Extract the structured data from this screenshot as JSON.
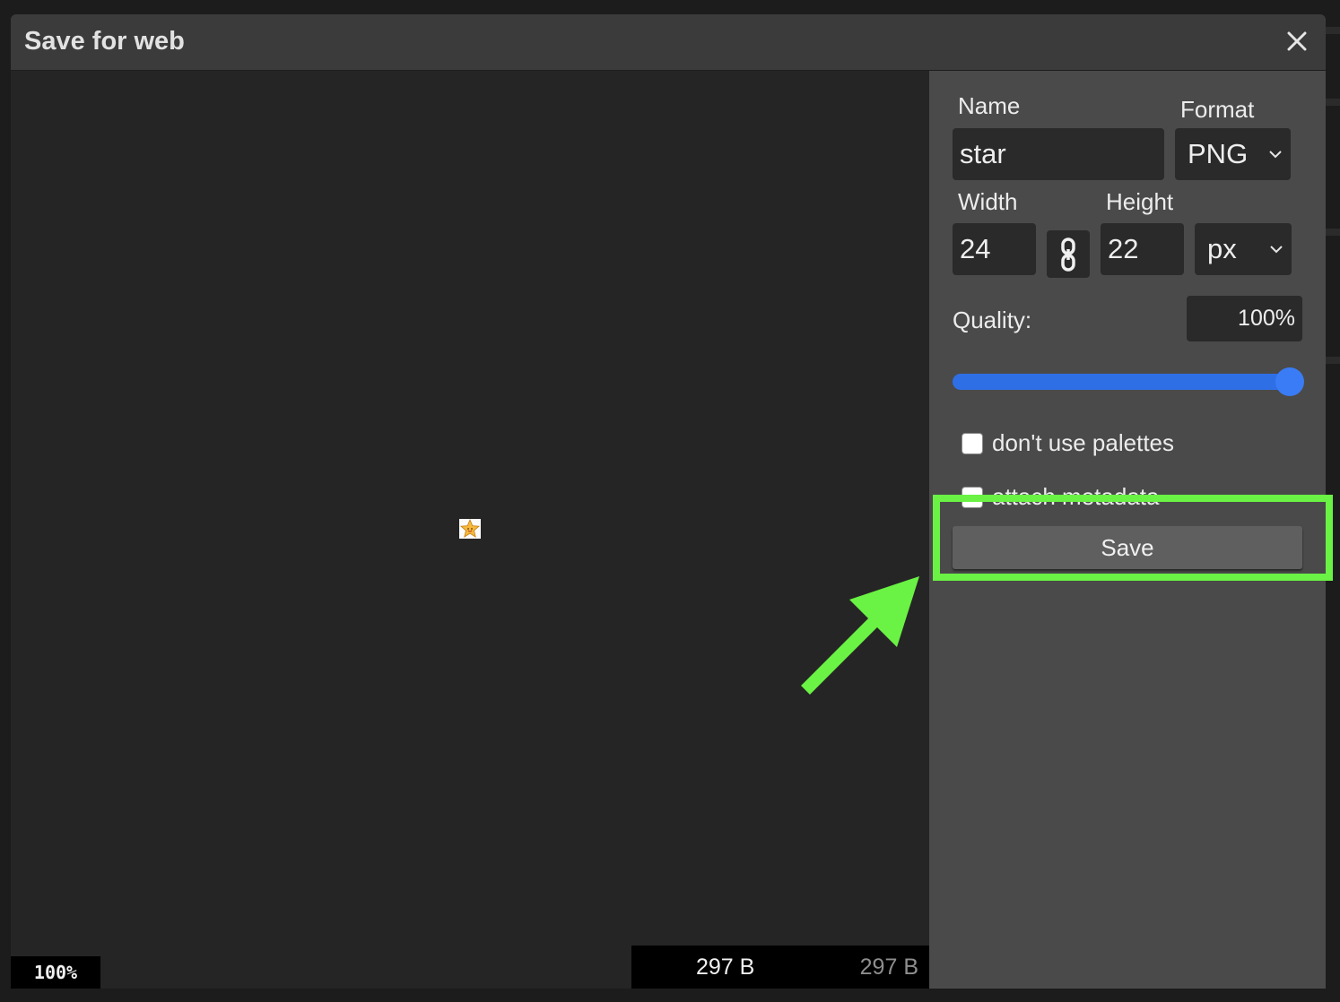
{
  "dialog": {
    "title": "Save for web",
    "close_icon": "close-icon"
  },
  "preview": {
    "zoom": "100%",
    "size_current": "297 B",
    "size_original": "297 B"
  },
  "settings": {
    "name_label": "Name",
    "name_value": "star",
    "format_label": "Format",
    "format_value": "PNG",
    "width_label": "Width",
    "width_value": "24",
    "height_label": "Height",
    "height_value": "22",
    "unit_value": "px",
    "quality_label": "Quality:",
    "quality_value": "100%",
    "quality_level": 1.0,
    "dont_use_palettes_label": "don't use palettes",
    "dont_use_palettes_checked": false,
    "attach_metadata_label": "attach metadata",
    "attach_metadata_checked": false,
    "save_label": "Save"
  },
  "annotation": {
    "highlight_color": "#6af244",
    "target": "save-button"
  },
  "colors": {
    "slider_accent": "#3a7cf5",
    "panel_bg": "#4a4a4a",
    "preview_bg": "#252525"
  }
}
